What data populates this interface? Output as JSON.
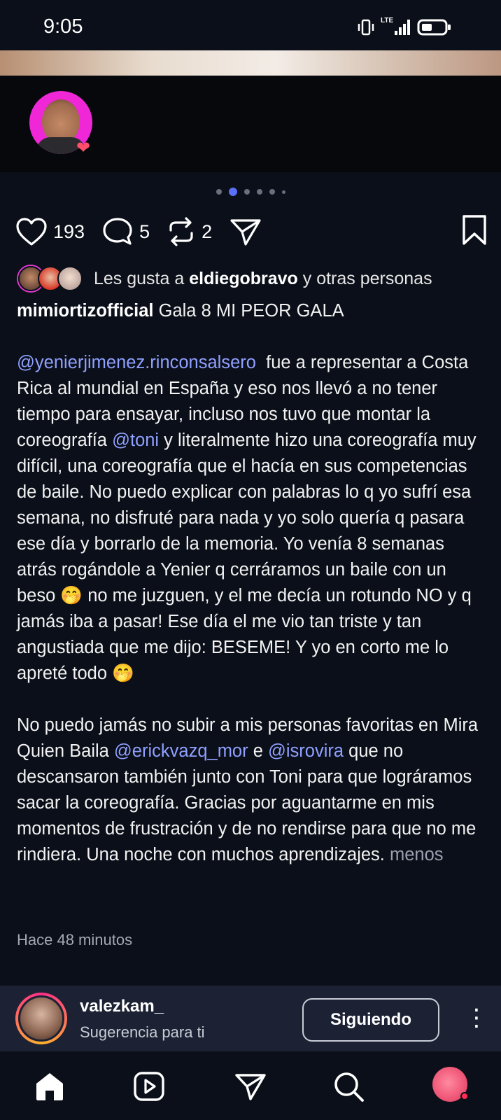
{
  "status": {
    "time": "9:05",
    "network": "LTE"
  },
  "post": {
    "counts": {
      "likes": "193",
      "comments": "5",
      "reposts": "2"
    },
    "liked_by": {
      "prefix": "Les gusta a",
      "user": "eldiegobravo",
      "suffix": "y otras personas"
    },
    "author": "mimiortizofficial",
    "title": "Gala 8 MI PEOR GALA",
    "p1": {
      "mention1": "@yenierjimenez.rinconsalsero",
      "text1": "  fue a representar a Costa Rica al mundial en España y eso nos llevó a no tener tiempo para ensayar, incluso nos tuvo que montar la coreografía ",
      "mention2": "@toni",
      "text2": " y literalmente hizo una coreografía muy difícil, una coreografía que el hacía en sus competencias de baile. No puedo explicar con palabras lo q yo sufrí esa semana, no disfruté para nada y yo solo quería q pasara ese día y borrarlo de  la memoria. Yo venía 8 semanas atrás rogándole a Yenier q cerráramos un baile con un beso 🤭 no me juzguen, y el me decía un rotundo NO y q jamás iba a pasar! Ese día el me vio tan triste y tan angustiada que me dijo: BESEME! Y yo en corto me lo apreté todo 🤭"
    },
    "p2": {
      "text1": "No puedo jamás no subir a mis personas favoritas en Mira Quien Baila ",
      "mention1": "@erickvazq_mor",
      "text2": " e ",
      "mention2": "@isrovira",
      "text3": " que no descansaron también junto con Toni para que lográramos sacar la coreografía. Gracias por aguantarme en mis momentos de frustración y de no rendirse para que no me rindiera. Una noche con muchos aprendizajes. ",
      "more": "menos"
    },
    "time_ago": "Hace 48 minutos"
  },
  "suggestion": {
    "username": "valezkam_",
    "subtitle": "Sugerencia para ti",
    "button": "Siguiendo"
  },
  "colors": {
    "background": "#0b0f19",
    "mention": "#8fa0ff",
    "carousel_active": "#5b6ff7",
    "suggestion_bg": "#1c2233"
  }
}
